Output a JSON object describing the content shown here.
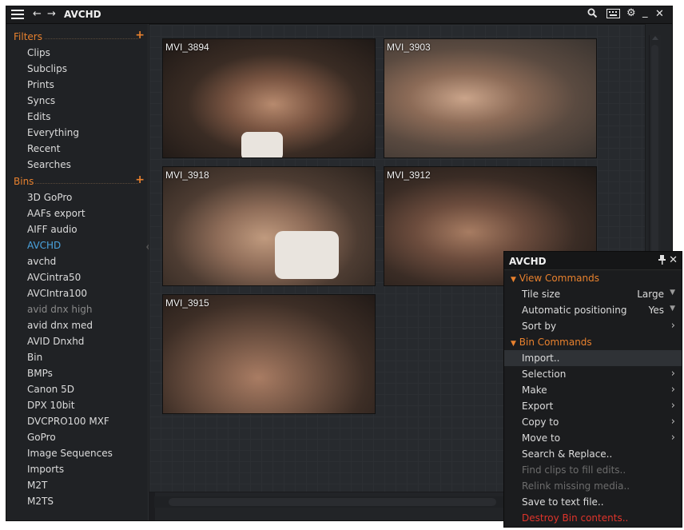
{
  "window": {
    "title": "AVCHD"
  },
  "sidebar": {
    "filters_heading": "Filters",
    "filters": [
      "Clips",
      "Subclips",
      "Prints",
      "Syncs",
      "Edits",
      "Everything",
      "Recent",
      "Searches"
    ],
    "bins_heading": "Bins",
    "bins": [
      "3D GoPro",
      "AAFs export",
      "AIFF audio",
      "AVCHD",
      "avchd",
      "AVCintra50",
      "AVCIntra100",
      "avid dnx high",
      "avid dnx med",
      "AVID Dnxhd",
      "Bin",
      "BMPs",
      "Canon 5D",
      "DPX 10bit",
      "DVCPRO100 MXF",
      "GoPro",
      "Image Sequences",
      "Imports",
      "M2T",
      "M2TS"
    ],
    "active_bin": "AVCHD",
    "dim_bin": "avid dnx high"
  },
  "clips": [
    "MVI_3894",
    "MVI_3903",
    "MVI_3918",
    "MVI_3912",
    "MVI_3915"
  ],
  "menu": {
    "title": "AVCHD",
    "view_section": "View Commands",
    "tile_size_label": "Tile size",
    "tile_size_value": "Large",
    "auto_pos_label": "Automatic positioning",
    "auto_pos_value": "Yes",
    "sort_by": "Sort by",
    "bin_section": "Bin Commands",
    "import": "Import..",
    "selection": "Selection",
    "make": "Make",
    "export": "Export",
    "copy_to": "Copy to",
    "move_to": "Move to",
    "search_replace": "Search & Replace..",
    "find_clips": "Find clips to fill edits..",
    "relink": "Relink missing media..",
    "save_text": "Save to text file..",
    "destroy": "Destroy Bin contents.."
  },
  "colors": {
    "accent": "#e8812e",
    "active": "#4aa3df",
    "danger": "#e0342b"
  }
}
